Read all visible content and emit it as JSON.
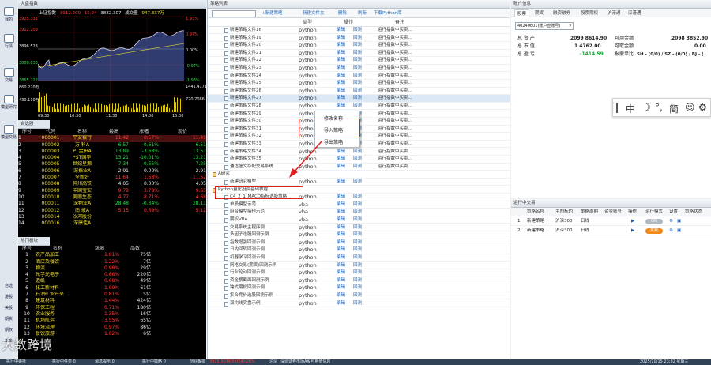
{
  "left_nav": {
    "items": [
      "我的",
      "行情",
      "交易",
      "模型研究",
      "模型交易"
    ],
    "bottom": [
      "自选",
      "港股",
      "美股",
      "期货",
      "期权",
      "基金"
    ]
  },
  "chart": {
    "title": "大盘指数",
    "index_name": "上证指数",
    "index_value": "3912.209",
    "index_change": "15.94",
    "h1": "3882.307",
    "h2": "成交量",
    "volume": "947.337万",
    "y_left": [
      "3925.331",
      "3912.209",
      "3896.523",
      "3880.833",
      "3865.222"
    ],
    "y_right": [
      "1.93%",
      "0.97%",
      "0.00%",
      "-0.97%",
      "-1.93%"
    ],
    "vol_left": [
      "860.220万",
      "430.110万"
    ],
    "vol_right": [
      "1441.4171",
      "720.7086"
    ],
    "times": [
      "09:30",
      "10:30",
      "11:30",
      "14:00",
      "15:00"
    ]
  },
  "quotes": {
    "title": "自选股",
    "cols": [
      "序号",
      "代码",
      "名称",
      "最高",
      "涨幅",
      "现价"
    ],
    "rows": [
      [
        "1",
        "000001",
        "平安银行",
        "11.42",
        "0.57%",
        "11.41"
      ],
      [
        "2",
        "000002",
        "万 科A",
        "6.57",
        "-0.61%",
        "6.51"
      ],
      [
        "3",
        "000003",
        "PT金田A",
        "13.89",
        "-3.68%",
        "13.57"
      ],
      [
        "4",
        "000004",
        "*ST国华",
        "13.21",
        "-10.01%",
        "13.21"
      ],
      [
        "5",
        "000005",
        "世纪星源",
        "7.34",
        "-0.55%",
        "7.25"
      ],
      [
        "6",
        "000006",
        "深振业A",
        "2.91",
        "0.00%",
        "2.91"
      ],
      [
        "7",
        "000007",
        "全新好",
        "11.64",
        "1.58%",
        "11.52"
      ],
      [
        "8",
        "000008",
        "神州高铁",
        "4.05",
        "0.00%",
        "4.05"
      ],
      [
        "9",
        "000009",
        "中国宝安",
        "9.79",
        "3.78%",
        "9.65"
      ],
      [
        "10",
        "000010",
        "美丽生态",
        "4.77",
        "8.71%",
        "4.68"
      ],
      [
        "11",
        "000011",
        "深物业A",
        "28.48",
        "-0.34%",
        "28.11"
      ],
      [
        "12",
        "000012",
        "南 玻A",
        "5.15",
        "0.59%",
        "5.12"
      ],
      [
        "13",
        "000014",
        "沙河股份",
        "",
        "",
        ""
      ],
      [
        "14",
        "000016",
        "深康佳A",
        "",
        "",
        ""
      ]
    ]
  },
  "sectors": {
    "title": "热门板块",
    "cols": [
      "序号",
      "名称",
      "涨幅",
      "品数"
    ],
    "rows": [
      [
        "1",
        "农产品加工",
        "1.01%",
        "75亿"
      ],
      [
        "2",
        "酒店及餐饮",
        "1.22%",
        "7亿"
      ],
      [
        "3",
        "物流",
        "0.98%",
        "29亿"
      ],
      [
        "4",
        "光学光电子",
        "0.86%",
        "220亿"
      ],
      [
        "5",
        "造纸",
        "0.68%",
        "49亿"
      ],
      [
        "6",
        "化工新材料",
        "1.09%",
        "61亿"
      ],
      [
        "7",
        "石油矿业开采",
        "0.81%",
        "5亿"
      ],
      [
        "8",
        "建筑材料",
        "1.44%",
        "424亿"
      ],
      [
        "9",
        "环保工程",
        "0.71%",
        "180亿"
      ],
      [
        "10",
        "农业服务",
        "1.35%",
        "16亿"
      ],
      [
        "11",
        "机场航运",
        "3.55%",
        "65亿"
      ],
      [
        "12",
        "环境治理",
        "0.97%",
        "86亿"
      ],
      [
        "13",
        "餐饮旅游",
        "1.02%",
        "6亿"
      ]
    ]
  },
  "strategy": {
    "title": "策略列表",
    "buttons": [
      "+新建策略",
      "新建文件夹",
      "删除",
      "刷新",
      "下载Python库"
    ],
    "cols": [
      "类型",
      "操作",
      "备注"
    ],
    "rows": [
      {
        "name": "新建策略文件16",
        "type": "python",
        "edit": "编辑",
        "run": "回测",
        "note": "运行指数中买卖..."
      },
      {
        "name": "新建策略文件19",
        "type": "python",
        "edit": "编辑",
        "run": "回测",
        "note": "运行指数中买卖..."
      },
      {
        "name": "新建策略文件20",
        "type": "python",
        "edit": "编辑",
        "run": "回测",
        "note": "运行指数中买卖..."
      },
      {
        "name": "新建策略文件21",
        "type": "python",
        "edit": "编辑",
        "run": "回测",
        "note": "运行指数中买卖..."
      },
      {
        "name": "新建策略文件22",
        "type": "python",
        "edit": "编辑",
        "run": "回测",
        "note": "运行指数中买卖..."
      },
      {
        "name": "新建策略文件23",
        "type": "python",
        "edit": "编辑",
        "run": "回测",
        "note": "运行指数中买卖..."
      },
      {
        "name": "新建策略文件24",
        "type": "python",
        "edit": "编辑",
        "run": "回测",
        "note": "运行指数中买卖..."
      },
      {
        "name": "新建策略文件25",
        "type": "python",
        "edit": "编辑",
        "run": "回测",
        "note": "运行指数中买卖..."
      },
      {
        "name": "新建策略文件26",
        "type": "python",
        "edit": "编辑",
        "run": "回测",
        "note": "运行指数中买卖..."
      },
      {
        "name": "新建策略文件27",
        "type": "python",
        "edit": "编辑",
        "run": "回测",
        "note": "运行指数中买卖..."
      },
      {
        "name": "新建策略文件28",
        "type": "python",
        "edit": "编辑",
        "run": "回测",
        "note": "运行指数中买卖..."
      },
      {
        "name": "新建策略文件29",
        "type": "python",
        "edit": "编辑",
        "run": "回测",
        "note": "运行指数中买卖..."
      },
      {
        "name": "新建策略文件30",
        "type": "python",
        "edit": "编辑",
        "run": "回测",
        "note": "运行指数中买卖..."
      },
      {
        "name": "新建策略文件31",
        "type": "python",
        "edit": "编辑",
        "run": "回测",
        "note": "运行指数中买卖..."
      },
      {
        "name": "新建策略文件32",
        "type": "python",
        "edit": "编辑",
        "run": "回测",
        "note": "运行指数中买卖..."
      },
      {
        "name": "新建策略文件33",
        "type": "python",
        "edit": "编辑",
        "run": "回测",
        "note": "运行指数中买卖..."
      },
      {
        "name": "新建策略文件34",
        "type": "python",
        "edit": "编辑",
        "run": "回测",
        "note": "运行指数中买卖..."
      },
      {
        "name": "新建策略文件35",
        "type": "python",
        "edit": "编辑",
        "run": "回测",
        "note": "运行指数中买卖..."
      },
      {
        "name": "通达信文华配交易系统",
        "type": "python",
        "edit": "编辑",
        "run": "回测",
        "note": "运行指数中买卖..."
      },
      {
        "name": "A研究",
        "type": "",
        "edit": "",
        "run": "",
        "note": "",
        "folder": true,
        "indent": 0
      },
      {
        "name": "新建研究模型",
        "type": "python",
        "edit": "编辑",
        "run": "回测",
        "note": ""
      },
      {
        "name": "Python量化投资基础教程",
        "type": "",
        "edit": "",
        "run": "",
        "note": "",
        "folder": true,
        "indent": 0
      },
      {
        "name": "C4_2_1_MACD指标选股策略",
        "type": "python",
        "edit": "编辑",
        "run": "回测",
        "note": ""
      },
      {
        "name": "单股模型示范",
        "type": "vba",
        "edit": "编辑",
        "run": "回测",
        "note": ""
      },
      {
        "name": "组合模型操作示范",
        "type": "vba",
        "edit": "编辑",
        "run": "回测",
        "note": ""
      },
      {
        "name": "期权VBA",
        "type": "vba",
        "edit": "编辑",
        "run": "回测",
        "note": ""
      },
      {
        "name": "交易系统主程序例",
        "type": "python",
        "edit": "编辑",
        "run": "回测",
        "note": ""
      },
      {
        "name": "多因子选股回测示例",
        "type": "python",
        "edit": "编辑",
        "run": "回测",
        "note": ""
      },
      {
        "name": "指数增强回测示例",
        "type": "python",
        "edit": "编辑",
        "run": "回测",
        "note": ""
      },
      {
        "name": "日内回转回测示例",
        "type": "python",
        "edit": "编辑",
        "run": "回测",
        "note": ""
      },
      {
        "name": "机器学习回测示例",
        "type": "python",
        "edit": "编辑",
        "run": "回测",
        "note": ""
      },
      {
        "name": "网格交易(期货)回测示例",
        "type": "python",
        "edit": "编辑",
        "run": "回测",
        "note": ""
      },
      {
        "name": "行业轮动回测示例",
        "type": "python",
        "edit": "编辑",
        "run": "回测",
        "note": ""
      },
      {
        "name": "资金横截面回测示例",
        "type": "python",
        "edit": "编辑",
        "run": "回测",
        "note": ""
      },
      {
        "name": "跨式期权回测示例",
        "type": "python",
        "edit": "编辑",
        "run": "回测",
        "note": ""
      },
      {
        "name": "集合竞价选股回测示例",
        "type": "python",
        "edit": "编辑",
        "run": "回测",
        "note": ""
      },
      {
        "name": "双均线实盘示例",
        "type": "python",
        "edit": "编辑",
        "run": "回测",
        "note": ""
      }
    ]
  },
  "context_menu": {
    "items": [
      "修改名称",
      "导入策略",
      "导出策略"
    ]
  },
  "account": {
    "title": "账户信息",
    "tabs": [
      "股票",
      "期货",
      "融资融券",
      "股票期权",
      "沪港通",
      "深港通"
    ],
    "select": "40240601(账户查账号)",
    "lines": [
      {
        "k": "总 资 产",
        "v": "2099 8614.90"
      },
      {
        "k": "总 市 值",
        "v": "1 4762.00"
      },
      {
        "k": "总 盈 亏",
        "v": "-1414.59"
      }
    ],
    "right": [
      {
        "k": "可用金额",
        "v": "2098 3852.90"
      },
      {
        "k": "可取金额",
        "v": "0.00"
      },
      {
        "k": "报撤单比",
        "v": "SH - (0/0) / SZ - (0/0) / BJ - ("
      }
    ]
  },
  "ime": {
    "items": [
      "中",
      "简"
    ]
  },
  "trading": {
    "title": "运行中交易",
    "cols": [
      "策略名称",
      "主图标的",
      "策略周期",
      "资金账号",
      "操作",
      "运行模式",
      "设置",
      "策略状态"
    ],
    "rows": [
      [
        "1",
        "新建策略",
        "沪深300",
        "日线",
        "",
        "",
        "",
        ""
      ],
      [
        "2",
        "新建策略",
        "沪深300",
        "日线",
        "",
        "",
        "",
        ""
      ]
    ],
    "mode_on": "ON",
    "mode_off": "买卖"
  },
  "status": {
    "items": [
      "执行中委托",
      "执行中任务 0",
      "消息提示 0",
      "执行中策略 0",
      "创业板指",
      "沪深",
      "深圳证券市场A股可用值信息",
      "2025/10/15 23:32 星期三"
    ],
    "vals": [
      "3925.307",
      "405.054",
      "-0.26%"
    ]
  },
  "watermark": "大数跨境"
}
